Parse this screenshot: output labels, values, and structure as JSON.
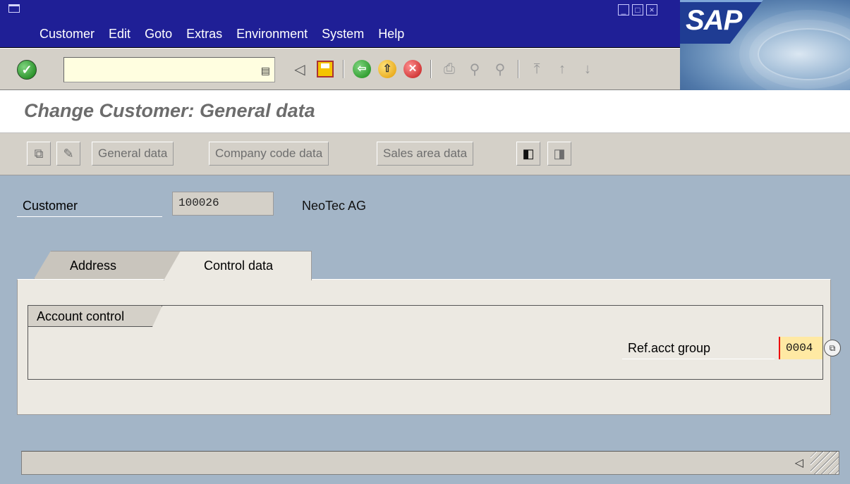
{
  "menu": {
    "items": [
      "Customer",
      "Edit",
      "Goto",
      "Extras",
      "Environment",
      "System",
      "Help"
    ]
  },
  "brand": {
    "logo_text": "SAP"
  },
  "toolbar": {
    "command_field_value": "",
    "icons": [
      "enter-icon",
      "back-icon",
      "save-icon",
      "back-green-icon",
      "exit-icon",
      "cancel-icon",
      "print-icon",
      "find-icon",
      "find-next-icon",
      "first-page-icon",
      "previous-page-icon",
      "next-page-icon"
    ]
  },
  "page": {
    "title": "Change Customer: General data"
  },
  "app_toolbar": {
    "buttons": [
      "General data",
      "Company code data",
      "Sales area data"
    ]
  },
  "header": {
    "customer_label": "Customer",
    "customer_value": "100026",
    "customer_name": "NeoTec AG"
  },
  "tabs": [
    {
      "label": "Address",
      "active": false
    },
    {
      "label": "Control data",
      "active": true
    }
  ],
  "account_control": {
    "group_title": "Account control",
    "ref_acct_group_label": "Ref.acct group",
    "ref_acct_group_value": "0004"
  },
  "status": {
    "text": "◁"
  }
}
